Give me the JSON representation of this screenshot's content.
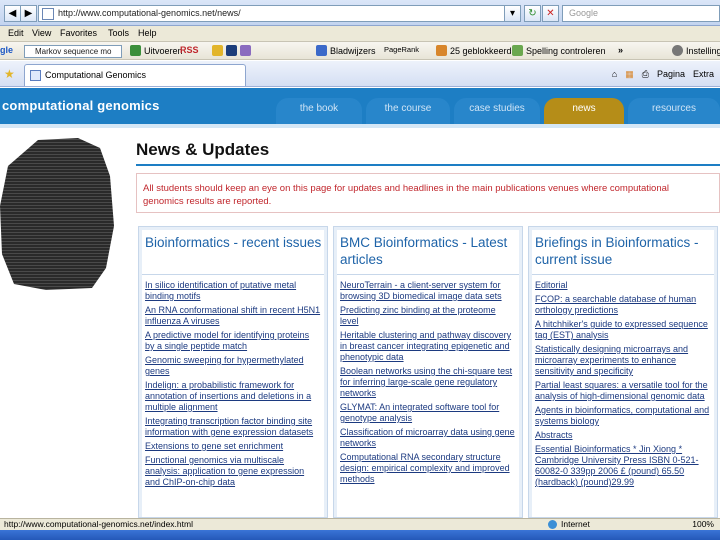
{
  "browser": {
    "address_url": "http://www.computational-genomics.net/news/",
    "search_placeholder": "Google",
    "menu": [
      "Edit",
      "View",
      "Favorites",
      "Tools",
      "Help"
    ],
    "toolbar": {
      "google_search_value": "Markov sequence mo",
      "items": [
        "Uitvoeren",
        "RSS",
        "Bladwijzers",
        "PageRank",
        "25 geblokkeerd",
        "Spelling controleren",
        "Instellingen"
      ]
    },
    "tab": {
      "label": "Computational Genomics"
    },
    "tab_tools": [
      "Pagina",
      "Extra"
    ],
    "status": {
      "url": "http://www.computational-genomics.net/index.html",
      "zone": "Internet",
      "zoom": "100%"
    }
  },
  "site": {
    "title": "computational genomics",
    "nav": [
      {
        "label": "the book",
        "active": false
      },
      {
        "label": "the course",
        "active": false
      },
      {
        "label": "case studies",
        "active": false
      },
      {
        "label": "news",
        "active": true
      },
      {
        "label": "resources",
        "active": false
      }
    ],
    "page_title": "News & Updates",
    "notice": "All students should keep an eye on this page for updates and headlines in the main publications venues where computational genomics results are reported.",
    "columns": [
      {
        "title": "Bioinformatics - recent issues",
        "items": [
          "In silico identification of putative metal binding motifs",
          "An RNA conformational shift in recent H5N1 influenza A viruses",
          "A predictive model for identifying proteins by a single peptide match",
          "Genomic sweeping for hypermethylated genes",
          "Indelign: a probabilistic framework for annotation of insertions and deletions in a multiple alignment",
          "Integrating transcription factor binding site information with gene expression datasets",
          "Extensions to gene set enrichment",
          "Functional genomics via multiscale analysis: application to gene expression and ChIP-on-chip data"
        ]
      },
      {
        "title": "BMC Bioinformatics - Latest articles",
        "items": [
          "NeuroTerrain - a client-server system for browsing 3D biomedical image data sets",
          "Predicting zinc binding at the proteome level",
          "Heritable clustering and pathway discovery in breast cancer integrating epigenetic and phenotypic data",
          "Boolean networks using the chi-square test for inferring large-scale gene regulatory networks",
          "GLYMAT: An integrated software tool for genotype analysis",
          "Classification of microarray data using gene networks",
          "Computational RNA secondary structure design: empirical complexity and improved methods"
        ]
      },
      {
        "title": "Briefings in Bioinformatics - current issue",
        "items": [
          "Editorial",
          "FCOP: a searchable database of human orthology predictions",
          "A hitchhiker's guide to expressed sequence tag (EST) analysis",
          "Statistically designing microarrays and microarray experiments to enhance sensitivity and specificity",
          "Partial least squares: a versatile tool for the analysis of high-dimensional genomic data",
          "Agents in bioinformatics, computational and systems biology",
          "Abstracts",
          "Essential Bioinformatics * Jin Xiong * Cambridge University Press ISBN 0-521-60082-0 339pp 2006 £ (pound) 65.50 (hardback) (pound)29.99"
        ]
      }
    ]
  }
}
